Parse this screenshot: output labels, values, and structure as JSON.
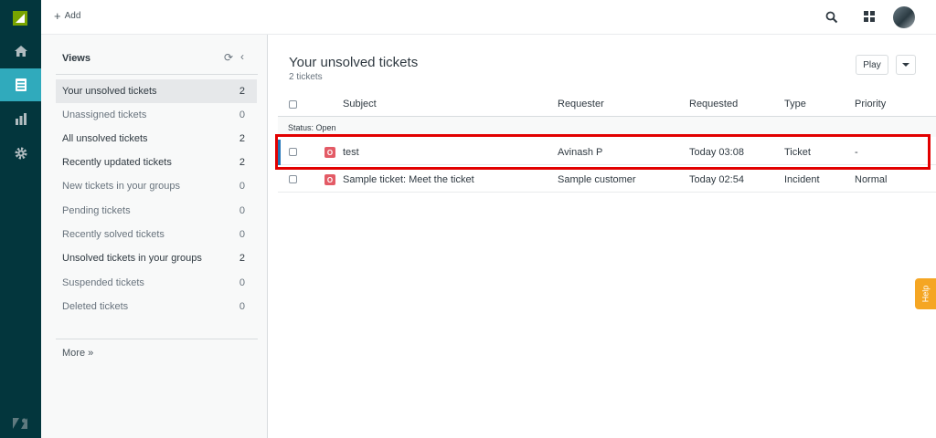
{
  "topbar": {
    "add_label": "Add",
    "icons": [
      "search-icon",
      "apps-grid-icon",
      "user-avatar"
    ]
  },
  "rail": {
    "icons": [
      "zendesk-logo",
      "home-icon",
      "views-icon",
      "reporting-icon",
      "admin-gear-icon",
      "zendesk-z-logo"
    ],
    "active": "views-icon",
    "colors": {
      "background": "#03363d",
      "active": "#30aabc"
    }
  },
  "views": {
    "heading": "Views",
    "items": [
      {
        "label": "Your unsolved tickets",
        "count": "2"
      },
      {
        "label": "Unassigned tickets",
        "count": "0"
      },
      {
        "label": "All unsolved tickets",
        "count": "2"
      },
      {
        "label": "Recently updated tickets",
        "count": "2"
      },
      {
        "label": "New tickets in your groups",
        "count": "0"
      },
      {
        "label": "Pending tickets",
        "count": "0"
      },
      {
        "label": "Recently solved tickets",
        "count": "0"
      },
      {
        "label": "Unsolved tickets in your groups",
        "count": "2"
      },
      {
        "label": "Suspended tickets",
        "count": "0"
      },
      {
        "label": "Deleted tickets",
        "count": "0"
      }
    ],
    "more_label": "More »"
  },
  "main": {
    "title": "Your unsolved tickets",
    "subtitle": "2 tickets",
    "play_label": "Play",
    "columns": {
      "subject": "Subject",
      "requester": "Requester",
      "requested": "Requested",
      "type": "Type",
      "priority": "Priority"
    },
    "group_label": "Status: Open",
    "rows": [
      {
        "status": "O",
        "subject": "test",
        "requester": "Avinash P",
        "requested": "Today 03:08",
        "type": "Ticket",
        "priority": "-"
      },
      {
        "status": "O",
        "subject": "Sample ticket: Meet the ticket",
        "requester": "Sample customer",
        "requested": "Today 02:54",
        "type": "Incident",
        "priority": "Normal"
      }
    ]
  },
  "help_label": "Help",
  "colors": {
    "open_badge": "#e35b66",
    "highlight": "#e20000",
    "help": "#f5a623"
  }
}
